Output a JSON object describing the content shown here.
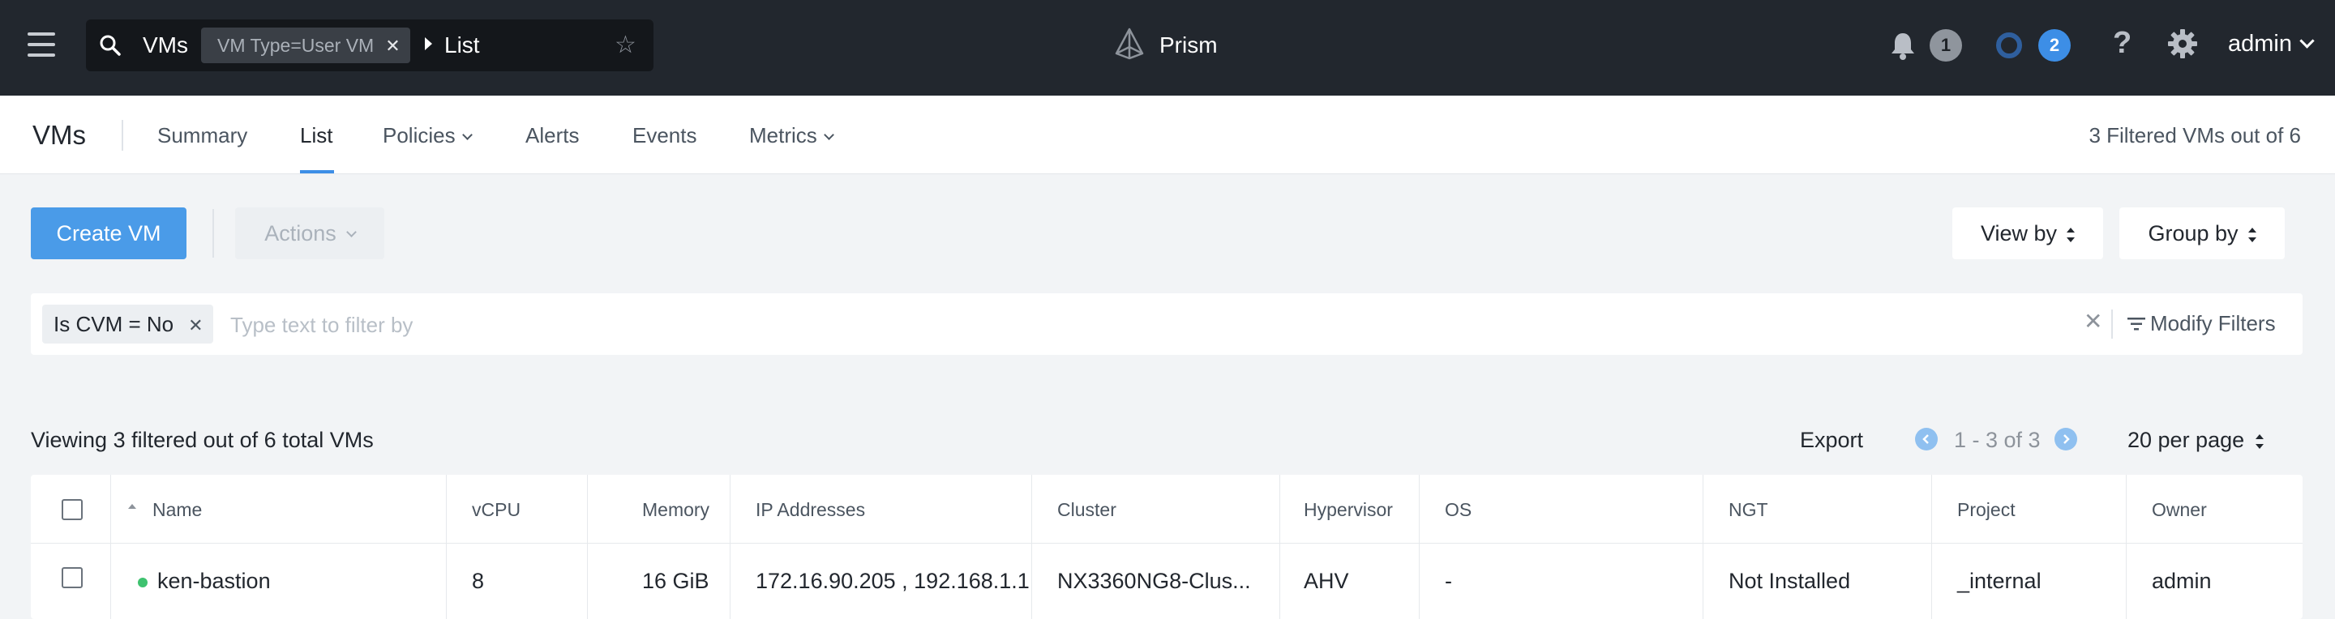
{
  "topbar": {
    "search_entity": "VMs",
    "filter_chip": "VM Type=User VM",
    "breadcrumb": "List",
    "brand": "Prism",
    "alerts_count": "1",
    "tasks_count": "2",
    "help": "?",
    "user": "admin"
  },
  "subnav": {
    "title": "VMs",
    "tabs": [
      {
        "label": "Summary"
      },
      {
        "label": "List"
      },
      {
        "label": "Policies"
      },
      {
        "label": "Alerts"
      },
      {
        "label": "Events"
      },
      {
        "label": "Metrics"
      }
    ],
    "active_tab": "List",
    "filtered_count": "3 Filtered VMs out of 6"
  },
  "toolbar": {
    "create_label": "Create VM",
    "actions_label": "Actions",
    "view_by": "View by",
    "group_by": "Group by"
  },
  "filterbar": {
    "chip": "Is CVM = No",
    "placeholder": "Type text to filter by",
    "modify": "Modify Filters"
  },
  "list": {
    "viewing": "Viewing 3 filtered out of 6 total VMs",
    "export": "Export",
    "range": "1 - 3 of 3",
    "per_page": "20 per page"
  },
  "table": {
    "columns": [
      "Name",
      "vCPU",
      "Memory",
      "IP Addresses",
      "Cluster",
      "Hypervisor",
      "OS",
      "NGT",
      "Project",
      "Owner"
    ],
    "rows": [
      {
        "name": "ken-bastion",
        "vcpu": "8",
        "memory": "16 GiB",
        "ip": "172.16.90.205 , 192.168.1.1",
        "cluster": "NX3360NG8-Clus...",
        "hypervisor": "AHV",
        "os": "-",
        "ngt": "Not Installed",
        "project": "_internal",
        "owner": "admin",
        "status": "on"
      }
    ]
  },
  "colors": {
    "topbar": "#22272e",
    "accent": "#4a9be8",
    "status_on": "#3ec26f"
  }
}
